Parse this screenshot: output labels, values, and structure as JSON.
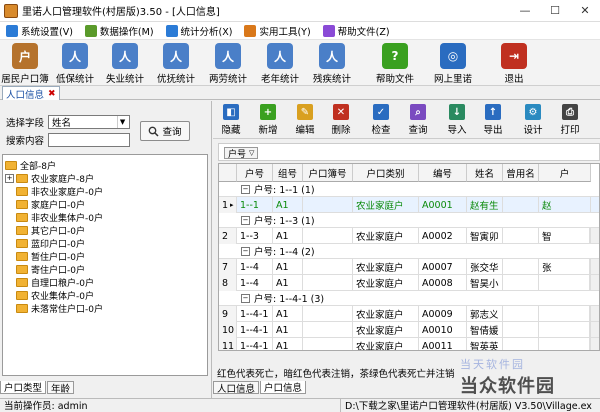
{
  "window": {
    "title": "里诺人口管理软件(村居版)3.50 - [人口信息]"
  },
  "menu": [
    {
      "label": "系统设置(V)",
      "color": "#2b7bd6"
    },
    {
      "label": "数据操作(M)",
      "color": "#5a9a2a"
    },
    {
      "label": "统计分析(X)",
      "color": "#2b7bd6"
    },
    {
      "label": "实用工具(Y)",
      "color": "#d9781a"
    },
    {
      "label": "帮助文件(Z)",
      "color": "#8a4ad6"
    }
  ],
  "toolbar": [
    {
      "label": "居民户口簿",
      "icon": "household-icon",
      "color": "#b5722c"
    },
    {
      "label": "低保统计",
      "icon": "person-icon",
      "color": "#4a7fc8"
    },
    {
      "label": "失业统计",
      "icon": "person-icon",
      "color": "#4a7fc8"
    },
    {
      "label": "优抚统计",
      "icon": "person-icon",
      "color": "#4a7fc8"
    },
    {
      "label": "两劳统计",
      "icon": "person-icon",
      "color": "#4a7fc8"
    },
    {
      "label": "老年统计",
      "icon": "person-icon",
      "color": "#4a7fc8"
    },
    {
      "label": "残疾统计",
      "icon": "person-icon",
      "color": "#4a7fc8"
    },
    {
      "label": "帮助文件",
      "icon": "help-icon",
      "color": "#3aa020"
    },
    {
      "label": "网上里诺",
      "icon": "web-icon",
      "color": "#2a6cc0"
    },
    {
      "label": "退出",
      "icon": "exit-icon",
      "color": "#c03020"
    }
  ],
  "doc_tab": {
    "label": "人口信息",
    "close": "✖"
  },
  "search": {
    "field_label": "选择字段",
    "field_value": "姓名",
    "content_label": "搜索内容",
    "query_label": "查询"
  },
  "tree": [
    {
      "label": "全部-8户",
      "expander": false
    },
    {
      "label": "农业家庭户-8户",
      "expander": true
    },
    {
      "label": "非农业家庭户-0户",
      "expander": false
    },
    {
      "label": "家庭户口-0户",
      "expander": false
    },
    {
      "label": "非农业集体户-0户",
      "expander": false
    },
    {
      "label": "其它户口-0户",
      "expander": false
    },
    {
      "label": "蓝印户口-0户",
      "expander": false
    },
    {
      "label": "暂住户口-0户",
      "expander": false
    },
    {
      "label": "寄住户口-0户",
      "expander": false
    },
    {
      "label": "自理口粮户-0户",
      "expander": false
    },
    {
      "label": "农业集体户-0户",
      "expander": false
    },
    {
      "label": "未落常住户口-0户",
      "expander": false
    }
  ],
  "left_tabs": [
    "户口类型",
    "年龄"
  ],
  "right_toolbar": [
    {
      "label": "隐藏",
      "icon": "hide-icon",
      "color": "#2a6cc0"
    },
    {
      "label": "新增",
      "icon": "add-icon",
      "color": "#3aa020"
    },
    {
      "label": "编辑",
      "icon": "edit-icon",
      "color": "#d9a020"
    },
    {
      "label": "删除",
      "icon": "delete-icon",
      "color": "#c03020"
    },
    {
      "label": "检查",
      "icon": "check-icon",
      "color": "#2a6cc0"
    },
    {
      "label": "查询",
      "icon": "query-icon",
      "color": "#7a4ac0"
    },
    {
      "label": "导入",
      "icon": "import-icon",
      "color": "#2a8a60"
    },
    {
      "label": "导出",
      "icon": "export-icon",
      "color": "#2a6cc0"
    },
    {
      "label": "设计",
      "icon": "design-icon",
      "color": "#2a8ac0"
    },
    {
      "label": "打印",
      "icon": "print-icon",
      "color": "#444444"
    }
  ],
  "group_chip": "户号",
  "grid": {
    "headers": [
      "户号",
      "组号",
      "户口簿号",
      "户口类别",
      "编号",
      "姓名",
      "曾用名",
      "户"
    ],
    "groups": [
      {
        "label": "户号: 1--1 (1)",
        "rows": [
          {
            "rn": "1",
            "cells": [
              "1--1",
              "A1",
              "",
              "农业家庭户",
              "A0001",
              "赵有生",
              "",
              "赵"
            ],
            "selected": true
          }
        ]
      },
      {
        "label": "户号: 1--3 (1)",
        "rows": [
          {
            "rn": "2",
            "cells": [
              "1--3",
              "A1",
              "",
              "农业家庭户",
              "A0002",
              "智寅卯",
              "",
              "智"
            ],
            "selected": false
          }
        ]
      },
      {
        "label": "户号: 1--4 (2)",
        "rows": [
          {
            "rn": "7",
            "cells": [
              "1--4",
              "A1",
              "",
              "农业家庭户",
              "A0007",
              "张交华",
              "",
              "张"
            ],
            "selected": false
          },
          {
            "rn": "8",
            "cells": [
              "1--4",
              "A1",
              "",
              "农业家庭户",
              "A0008",
              "智昊小",
              "",
              ""
            ],
            "selected": false
          }
        ]
      },
      {
        "label": "户号: 1--4-1 (3)",
        "rows": [
          {
            "rn": "9",
            "cells": [
              "1--4-1",
              "A1",
              "",
              "农业家庭户",
              "A0009",
              "郭志义",
              "",
              ""
            ],
            "selected": false
          },
          {
            "rn": "10",
            "cells": [
              "1--4-1",
              "A1",
              "",
              "农业家庭户",
              "A0010",
              "智倩媛",
              "",
              ""
            ],
            "selected": false
          },
          {
            "rn": "11",
            "cells": [
              "1--4-1",
              "A1",
              "",
              "农业家庭户",
              "A0011",
              "智英英",
              "",
              ""
            ],
            "selected": false
          }
        ]
      }
    ]
  },
  "legend": "红色代表死亡，暗红色代表注销，茶绿色代表死亡并注销",
  "right_tabs": [
    "人口信息",
    "户口信息"
  ],
  "status": {
    "operator": "当前操作员: admin",
    "path": "D:\\下载之家\\里诺户口管理软件(村居版) V3.50\\Village.ex"
  },
  "watermark": {
    "top": "当天软件园",
    "bottom": "当众软件园"
  }
}
